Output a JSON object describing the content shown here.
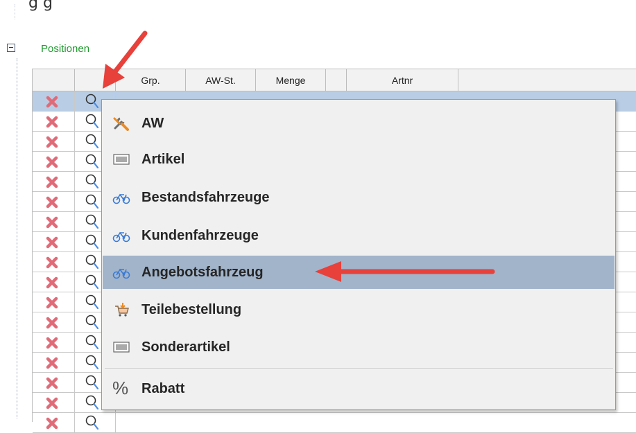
{
  "caption": "g        g",
  "section": {
    "title": "Positionen"
  },
  "table": {
    "columns": [
      "",
      "",
      "Grp.",
      "AW-St.",
      "Menge",
      "",
      "Artnr"
    ],
    "row_count": 17
  },
  "context_menu": {
    "items": [
      {
        "label": "AW",
        "icon": "tools-icon"
      },
      {
        "label": "Artikel",
        "icon": "barcode-icon"
      },
      {
        "label": "Bestandsfahrzeuge",
        "icon": "bicycle-icon"
      },
      {
        "label": "Kundenfahrzeuge",
        "icon": "bicycle-icon"
      },
      {
        "label": "Angebotsfahrzeug",
        "icon": "bicycle-icon",
        "highlighted": true
      },
      {
        "label": "Teilebestellung",
        "icon": "cart-icon"
      },
      {
        "label": "Sonderartikel",
        "icon": "barcode-icon"
      },
      {
        "label": "Rabatt",
        "icon": "percent-icon"
      }
    ]
  },
  "colors": {
    "section_title": "#1e9a2d",
    "selected_row": "#b9cde5",
    "menu_highlight": "#a2b4ca",
    "annotation_arrow": "#e8403a",
    "delete_icon": "#e06b78"
  }
}
